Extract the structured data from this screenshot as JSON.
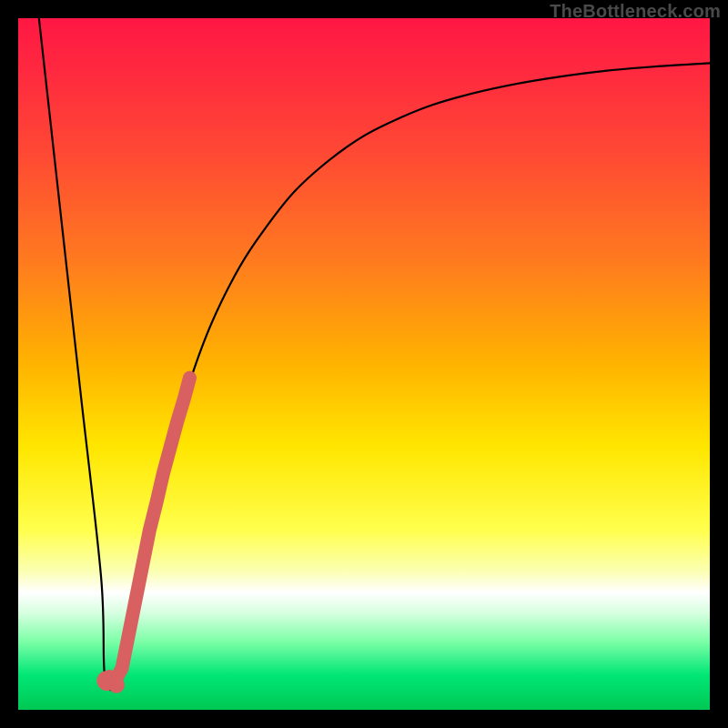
{
  "watermark": "TheBottleneck.com",
  "colors": {
    "frame": "#000000",
    "curve": "#000000",
    "markers": "#d86060",
    "gradient_stops": [
      {
        "offset": 0.0,
        "color": "#ff1744"
      },
      {
        "offset": 0.08,
        "color": "#ff2a3f"
      },
      {
        "offset": 0.2,
        "color": "#ff4a33"
      },
      {
        "offset": 0.35,
        "color": "#ff7a1f"
      },
      {
        "offset": 0.5,
        "color": "#ffb300"
      },
      {
        "offset": 0.62,
        "color": "#ffe600"
      },
      {
        "offset": 0.74,
        "color": "#ffff4d"
      },
      {
        "offset": 0.8,
        "color": "#fbffb3"
      },
      {
        "offset": 0.83,
        "color": "#ffffff"
      },
      {
        "offset": 0.86,
        "color": "#d6ffe0"
      },
      {
        "offset": 0.9,
        "color": "#7fffa8"
      },
      {
        "offset": 0.95,
        "color": "#00e676"
      },
      {
        "offset": 1.0,
        "color": "#00c853"
      }
    ]
  },
  "chart_data": {
    "type": "line",
    "title": "",
    "xlabel": "",
    "ylabel": "",
    "xlim": [
      0,
      100
    ],
    "ylim": [
      0,
      100
    ],
    "series": [
      {
        "name": "bottleneck-curve",
        "x": [
          3,
          6,
          9,
          12,
          12.5,
          14,
          15,
          17,
          19,
          22,
          25,
          28,
          32,
          36,
          40,
          45,
          50,
          55,
          60,
          66,
          72,
          78,
          85,
          92,
          100
        ],
        "y": [
          100,
          73,
          46,
          19,
          5,
          3,
          6,
          16,
          26,
          38,
          48,
          56,
          64,
          70,
          75,
          79.5,
          83,
          85.5,
          87.5,
          89.2,
          90.5,
          91.5,
          92.4,
          93,
          93.5
        ]
      }
    ],
    "markers": {
      "name": "highlight-segment",
      "x": [
        13.2,
        14.0,
        15.0,
        16.0,
        17.0,
        18.0,
        19.0,
        20.0,
        21.0,
        22.0,
        23.0,
        24.0,
        24.8
      ],
      "y": [
        4.8,
        4.2,
        6.0,
        11.0,
        16.0,
        21.0,
        26.0,
        30.0,
        34.3,
        38.0,
        41.7,
        45.0,
        48.0
      ]
    }
  }
}
